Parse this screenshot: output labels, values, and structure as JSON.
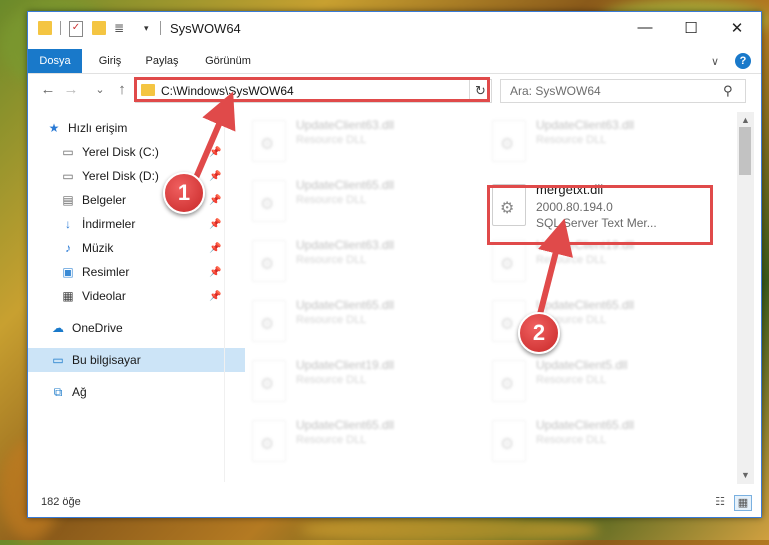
{
  "window": {
    "title": "SysWOW64",
    "minimize_glyph": "—",
    "maximize_glyph": "☐",
    "close_glyph": "✕"
  },
  "ribbon": {
    "tabs": [
      "Dosya",
      "Giriş",
      "Paylaş",
      "Görünüm"
    ],
    "collapse_glyph": "∨",
    "help_glyph": "?"
  },
  "nav": {
    "back_glyph": "←",
    "forward_glyph": "→",
    "recent_glyph": "⌄",
    "up_glyph": "↑",
    "address": "C:\\Windows\\SysWOW64",
    "dropdown_glyph": "⌄",
    "refresh_glyph": "↻",
    "search_placeholder": "Ara: SysWOW64"
  },
  "sidebar": {
    "items": [
      {
        "label": "Hızlı erişim",
        "icon": "star-icon",
        "pinned": false
      },
      {
        "label": "Yerel Disk (C:)",
        "icon": "drive-icon",
        "pinned": true
      },
      {
        "label": "Yerel Disk (D:)",
        "icon": "drive-icon",
        "pinned": true
      },
      {
        "label": "Belgeler",
        "icon": "documents-icon",
        "pinned": true
      },
      {
        "label": "İndirmeler",
        "icon": "download-icon",
        "pinned": true
      },
      {
        "label": "Müzik",
        "icon": "music-icon",
        "pinned": true
      },
      {
        "label": "Resimler",
        "icon": "pictures-icon",
        "pinned": true
      },
      {
        "label": "Videolar",
        "icon": "videos-icon",
        "pinned": true
      },
      {
        "label": "OneDrive",
        "icon": "cloud-icon",
        "pinned": false
      },
      {
        "label": "Bu bilgisayar",
        "icon": "computer-icon",
        "pinned": false,
        "selected": true
      },
      {
        "label": "Ağ",
        "icon": "network-icon",
        "pinned": false
      }
    ]
  },
  "files": {
    "left_column": [
      {
        "name": "UpdateClient63.dll",
        "desc": "Resource DLL"
      },
      {
        "name": "UpdateClient65.dll",
        "desc": "Resource DLL"
      },
      {
        "name": "UpdateClient63.dll",
        "desc": "Resource DLL"
      },
      {
        "name": "UpdateClient65.dll",
        "desc": "Resource DLL"
      },
      {
        "name": "UpdateClient19.dll",
        "desc": "Resource DLL"
      },
      {
        "name": "UpdateClient65.dll",
        "desc": "Resource DLL"
      }
    ],
    "right_column": [
      {
        "name": "UpdateClient63.dll",
        "desc": "Resource DLL"
      },
      {
        "name": "mergetxt.dll",
        "version": "2000.80.194.0",
        "desc": "SQL Server Text Mer...",
        "highlighted": true
      },
      {
        "name": "UpdateClient19.dll",
        "desc": "Resource DLL"
      },
      {
        "name": "UpdateClient65.dll",
        "desc": "Resource DLL"
      },
      {
        "name": "UpdateClient5.dll",
        "desc": "Resource DLL"
      },
      {
        "name": "UpdateClient65.dll",
        "desc": "Resource DLL"
      }
    ]
  },
  "status": {
    "item_count": "182 öğe"
  },
  "annotations": {
    "step1": "1",
    "step2": "2",
    "color": "#e04a4a"
  }
}
